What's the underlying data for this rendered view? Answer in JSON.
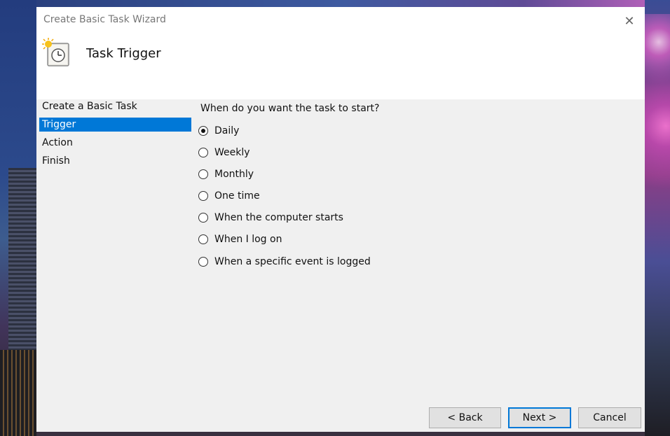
{
  "window": {
    "title": "Create Basic Task Wizard",
    "close_glyph": "✕"
  },
  "header": {
    "title": "Task Trigger",
    "icon": "task-clock-icon"
  },
  "steps": [
    {
      "label": "Create a Basic Task",
      "active": false
    },
    {
      "label": "Trigger",
      "active": true
    },
    {
      "label": "Action",
      "active": false
    },
    {
      "label": "Finish",
      "active": false
    }
  ],
  "main": {
    "question": "When do you want the task to start?",
    "options": [
      {
        "label": "Daily",
        "selected": true
      },
      {
        "label": "Weekly",
        "selected": false
      },
      {
        "label": "Monthly",
        "selected": false
      },
      {
        "label": "One time",
        "selected": false
      },
      {
        "label": "When the computer starts",
        "selected": false
      },
      {
        "label": "When I log on",
        "selected": false
      },
      {
        "label": "When a specific event is logged",
        "selected": false
      }
    ]
  },
  "buttons": {
    "back": "< Back",
    "next": "Next >",
    "cancel": "Cancel"
  },
  "colors": {
    "accent": "#0078d7",
    "dialog_bg": "#f0f0f0",
    "header_bg": "#ffffff"
  }
}
